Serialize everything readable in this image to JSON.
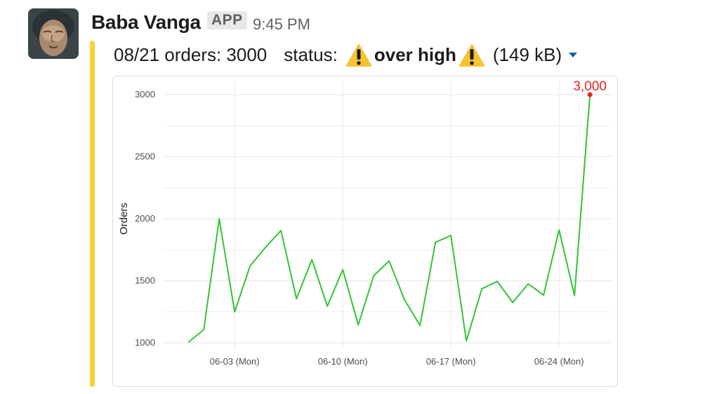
{
  "message": {
    "sender": "Baba Vanga",
    "badge": "APP",
    "time": "9:45 PM",
    "text_prefix": "08/21 orders: 3000",
    "status_label": "status:",
    "status_value": "over high",
    "file_size": "(149 kB)",
    "icons": {
      "avatar": "avatar-photo",
      "warning": "warning-sign-emoji",
      "expand": "caret-down-icon"
    },
    "colors": {
      "accent_bar": "#f9d333",
      "caret": "#1264a3"
    }
  },
  "chart_data": {
    "type": "line",
    "title": "",
    "xlabel": "",
    "ylabel": "Orders",
    "ylim": [
      1000,
      3000
    ],
    "yticks": [
      "1000",
      "1500",
      "2000",
      "2500",
      "3000"
    ],
    "xticks": [
      {
        "date": "06-03",
        "label": "06-03 (Mon)"
      },
      {
        "date": "06-10",
        "label": "06-10 (Mon)"
      },
      {
        "date": "06-17",
        "label": "06-17 (Mon)"
      },
      {
        "date": "06-24",
        "label": "06-24 (Mon)"
      }
    ],
    "grid": true,
    "series": [
      {
        "color": "#33c433",
        "points": [
          {
            "x": "05-31",
            "y": 1005
          },
          {
            "x": "06-01",
            "y": 1105
          },
          {
            "x": "06-02",
            "y": 2000
          },
          {
            "x": "06-03",
            "y": 1250
          },
          {
            "x": "06-04",
            "y": 1620
          },
          {
            "x": "06-05",
            "y": 1770
          },
          {
            "x": "06-06",
            "y": 1905
          },
          {
            "x": "06-07",
            "y": 1355
          },
          {
            "x": "06-08",
            "y": 1670
          },
          {
            "x": "06-09",
            "y": 1295
          },
          {
            "x": "06-10",
            "y": 1590
          },
          {
            "x": "06-11",
            "y": 1145
          },
          {
            "x": "06-12",
            "y": 1540
          },
          {
            "x": "06-13",
            "y": 1660
          },
          {
            "x": "06-14",
            "y": 1345
          },
          {
            "x": "06-15",
            "y": 1140
          },
          {
            "x": "06-16",
            "y": 1810
          },
          {
            "x": "06-17",
            "y": 1865
          },
          {
            "x": "06-18",
            "y": 1015
          },
          {
            "x": "06-19",
            "y": 1435
          },
          {
            "x": "06-20",
            "y": 1495
          },
          {
            "x": "06-21",
            "y": 1325
          },
          {
            "x": "06-22",
            "y": 1475
          },
          {
            "x": "06-23",
            "y": 1385
          },
          {
            "x": "06-24",
            "y": 1910
          },
          {
            "x": "06-25",
            "y": 1380
          },
          {
            "x": "06-26",
            "y": 3000
          }
        ]
      }
    ],
    "annotations": [
      {
        "x": "06-26",
        "y": 3000,
        "text": "3,000",
        "color": "#ee2222"
      }
    ]
  }
}
